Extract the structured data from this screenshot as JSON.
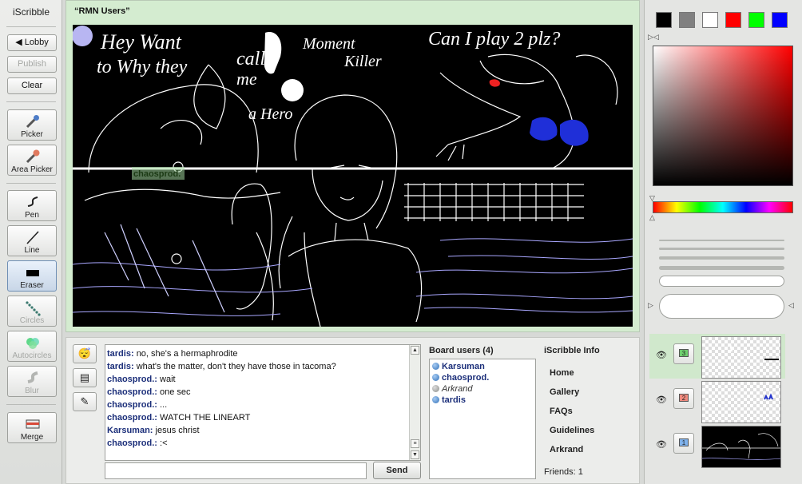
{
  "app": {
    "title": "iScribble"
  },
  "toolbar": {
    "lobby_label": "Lobby",
    "publish_label": "Publish",
    "clear_label": "Clear",
    "tools": [
      {
        "label": "Picker",
        "icon": "eyedropper-icon",
        "active": false,
        "disabled": false
      },
      {
        "label": "Area Picker",
        "icon": "area-picker-icon",
        "active": false,
        "disabled": false
      },
      {
        "label": "Pen",
        "icon": "pen-icon",
        "active": false,
        "disabled": false
      },
      {
        "label": "Line",
        "icon": "line-icon",
        "active": false,
        "disabled": false
      },
      {
        "label": "Eraser",
        "icon": "eraser-icon",
        "active": true,
        "disabled": false
      },
      {
        "label": "Circles",
        "icon": "circles-icon",
        "active": false,
        "disabled": true
      },
      {
        "label": "Autocircles",
        "icon": "autocircles-icon",
        "active": false,
        "disabled": true
      },
      {
        "label": "Blur",
        "icon": "blur-icon",
        "active": false,
        "disabled": true
      }
    ],
    "merge_label": "Merge"
  },
  "board": {
    "title": "“RMN Users”",
    "drawing_texts": {
      "hey": "Hey Want",
      "to_why": "to Why they",
      "call": "call",
      "me": "me",
      "hero": "a Hero",
      "moment": "Moment",
      "killer": "Killer",
      "can": "Can I play 2 plz?"
    },
    "cursor_user": "chaosprod."
  },
  "chat": {
    "messages": [
      {
        "user": "tardis:",
        "text": "no, she's a hermaphrodite"
      },
      {
        "user": "tardis:",
        "text": "what's the matter, don't they have those in tacoma?"
      },
      {
        "user": "chaosprod.:",
        "text": "wait"
      },
      {
        "user": "chaosprod.:",
        "text": "one sec"
      },
      {
        "user": "chaosprod.:",
        "text": "..."
      },
      {
        "user": "chaosprod.:",
        "text": "WATCH THE LINEART"
      },
      {
        "user": "Karsuman:",
        "text": "jesus christ"
      },
      {
        "user": "chaosprod.:",
        "text": ":<"
      }
    ],
    "input_value": "",
    "send_label": "Send"
  },
  "users": {
    "title": "Board users (4)",
    "list": [
      {
        "name": "Karsuman",
        "idle": false
      },
      {
        "name": "chaosprod.",
        "idle": false
      },
      {
        "name": "Arkrand",
        "idle": true
      },
      {
        "name": "tardis",
        "idle": false
      }
    ]
  },
  "info": {
    "title": "iScribble Info",
    "links": [
      "Home",
      "Gallery",
      "FAQs",
      "Guidelines",
      "Arkrand"
    ],
    "friends": "Friends: 1"
  },
  "palette": {
    "swatches": [
      "#000000",
      "#808080",
      "#ffffff",
      "#ff0000",
      "#00ff00",
      "#0000ff"
    ]
  },
  "layers": [
    {
      "number": "3",
      "selected": true,
      "color": "#4caf50"
    },
    {
      "number": "2",
      "selected": false,
      "color": "#e57368"
    },
    {
      "number": "1",
      "selected": false,
      "color": "#4a8fd8"
    }
  ]
}
